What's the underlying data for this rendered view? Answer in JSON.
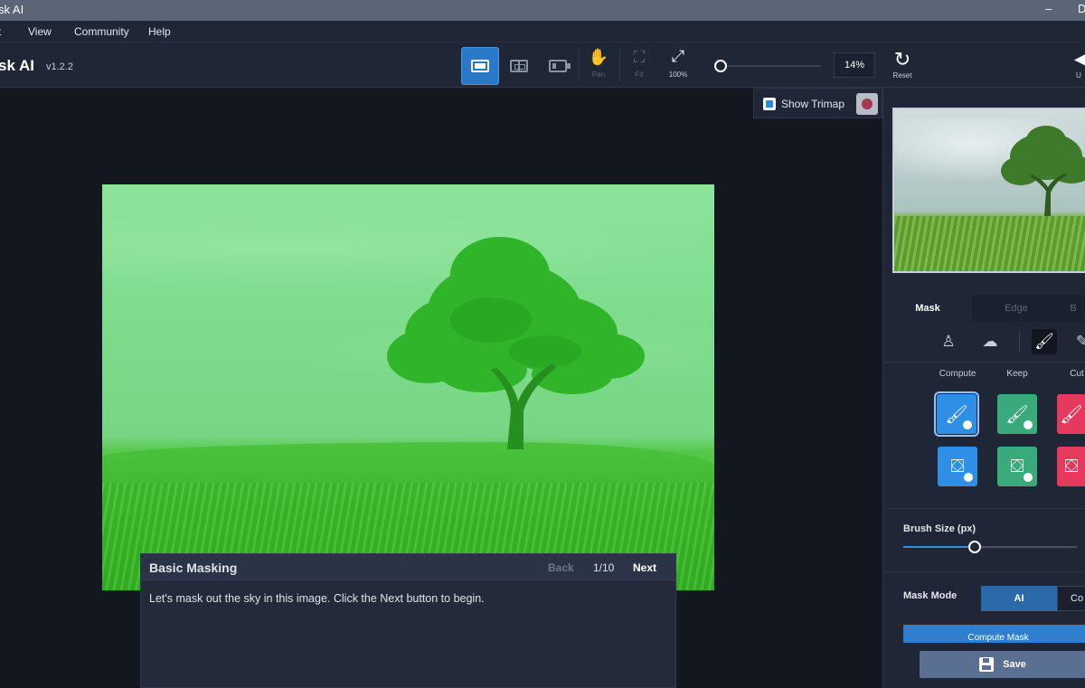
{
  "window": {
    "title": "sk AI",
    "min_glyph": "–",
    "max_glyph": "D"
  },
  "menu": {
    "items": [
      "t",
      "View",
      "Community",
      "Help"
    ]
  },
  "toolbar": {
    "app_name": "sk AI",
    "version": "v1.2.2",
    "pan_label": "Pan",
    "fit_label": "Fit",
    "full_label": "100%",
    "zoom_value": "14%",
    "zoom_fraction": 0.0,
    "reset_label": "Reset",
    "undo_label": "U"
  },
  "canvas": {
    "show_trimap_label": "Show Trimap",
    "trimap_color": "#a63850",
    "mask_overlay_color": "#59d35c"
  },
  "tutorial": {
    "title": "Basic Masking",
    "back_label": "Back",
    "page": "1/10",
    "next_label": "Next",
    "body": "Let's mask out the sky in this image. Click the Next button to begin."
  },
  "panel": {
    "tabs": [
      "Mask",
      "Edge",
      "B"
    ],
    "columns": [
      "Compute",
      "Keep",
      "Cut"
    ],
    "brush_size_label": "Brush Size (px)",
    "brush_size_fraction": 0.41,
    "mask_mode_label": "Mask Mode",
    "mask_mode_ai": "AI",
    "mask_mode_other": "Co",
    "compute_mask_label": "Compute Mask",
    "save_label": "Save",
    "colors": {
      "compute": "#2f8fe6",
      "keep": "#3aaa7a",
      "cut": "#e53a5e",
      "accent": "#2a79c8"
    }
  }
}
